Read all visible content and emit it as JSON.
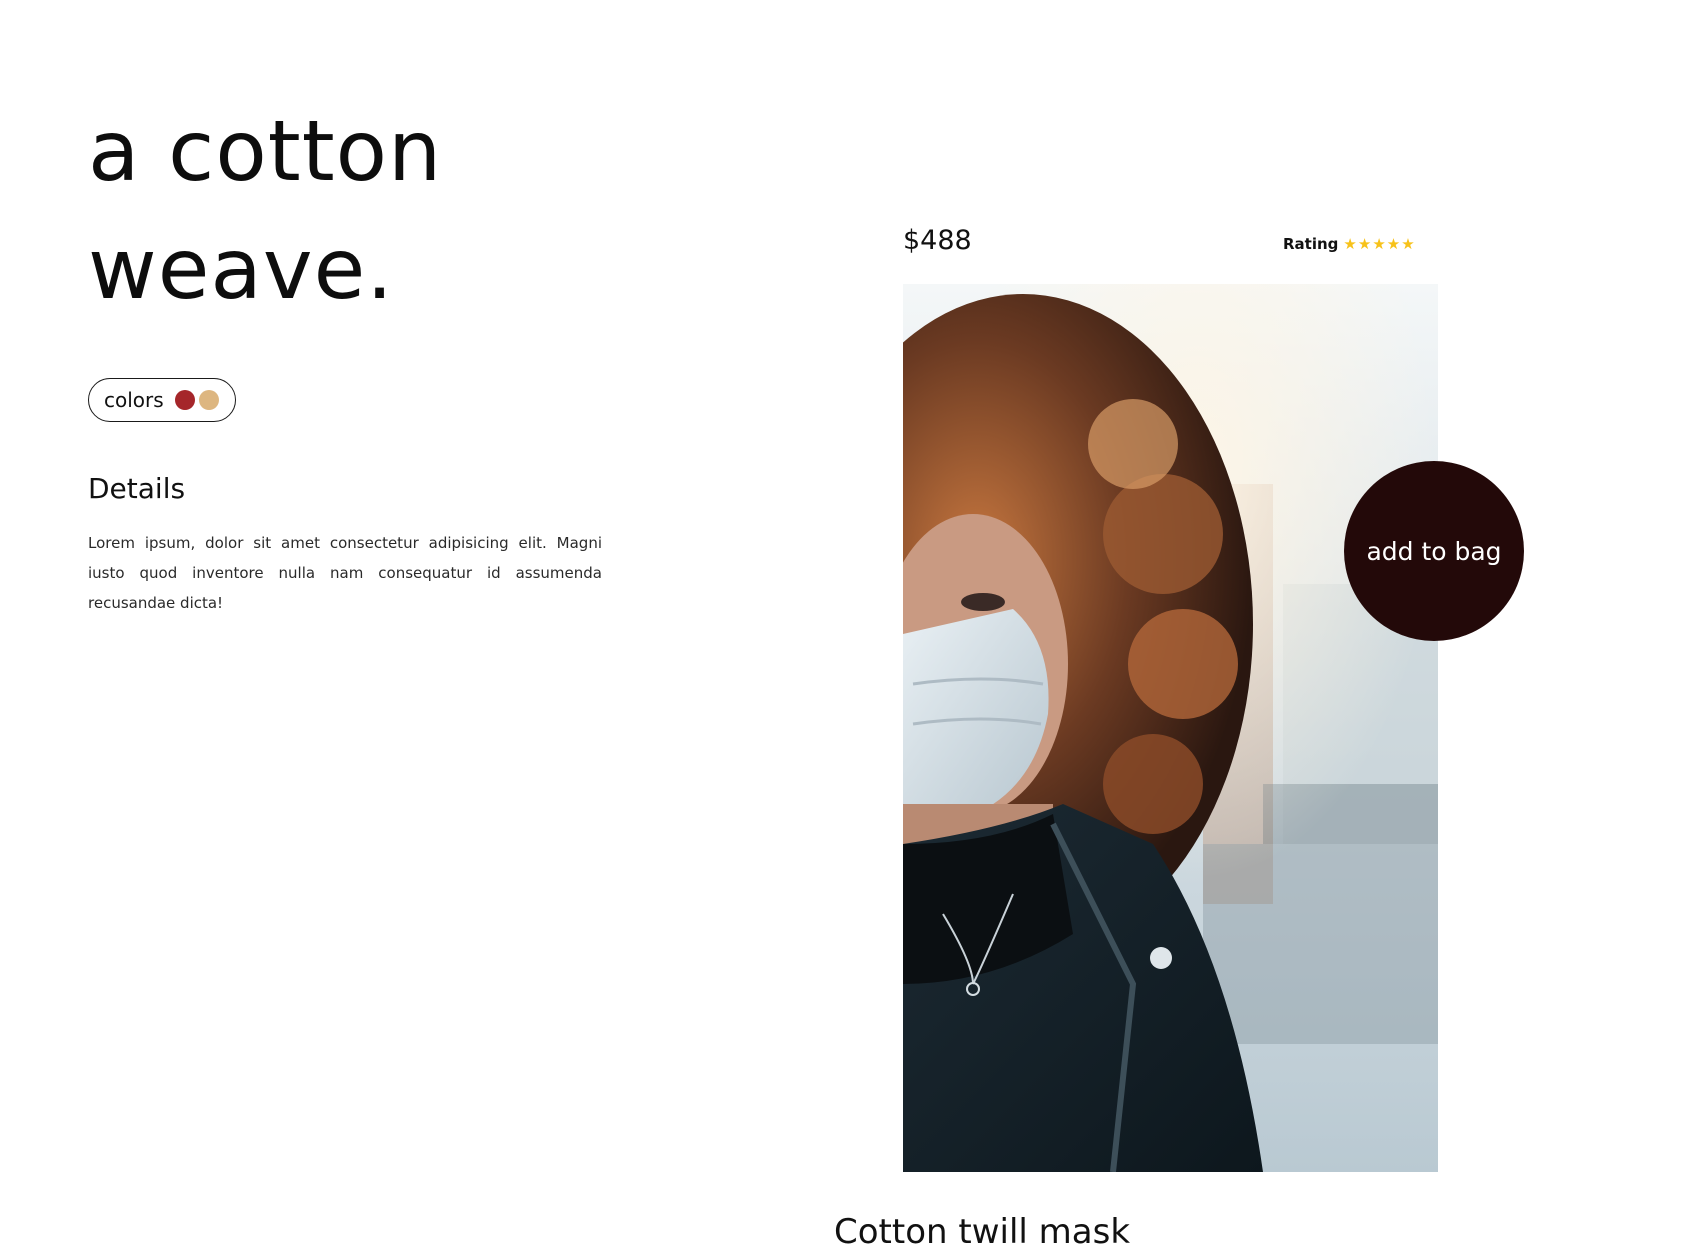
{
  "hero": {
    "headline_line1": "a cotton",
    "headline_line2": "weave."
  },
  "colors": {
    "label": "colors",
    "swatches": [
      {
        "name": "red",
        "hex": "#a5262a"
      },
      {
        "name": "tan",
        "hex": "#ddb680"
      }
    ]
  },
  "details": {
    "title": "Details",
    "text": "Lorem ipsum, dolor sit amet consectetur adipisicing elit. Magni iusto quod inventore nulla nam consequatur id assumenda recusandae dicta!"
  },
  "product": {
    "price": "$488",
    "rating_label": "Rating",
    "rating_stars": 5,
    "rating_max": 5,
    "star_color": "#f7c21a",
    "photo_icon": "product-photo-woman-in-mask",
    "add_to_bag_label": "add to bag",
    "add_to_bag_color": "#230909",
    "name": "Cotton twill mask"
  }
}
